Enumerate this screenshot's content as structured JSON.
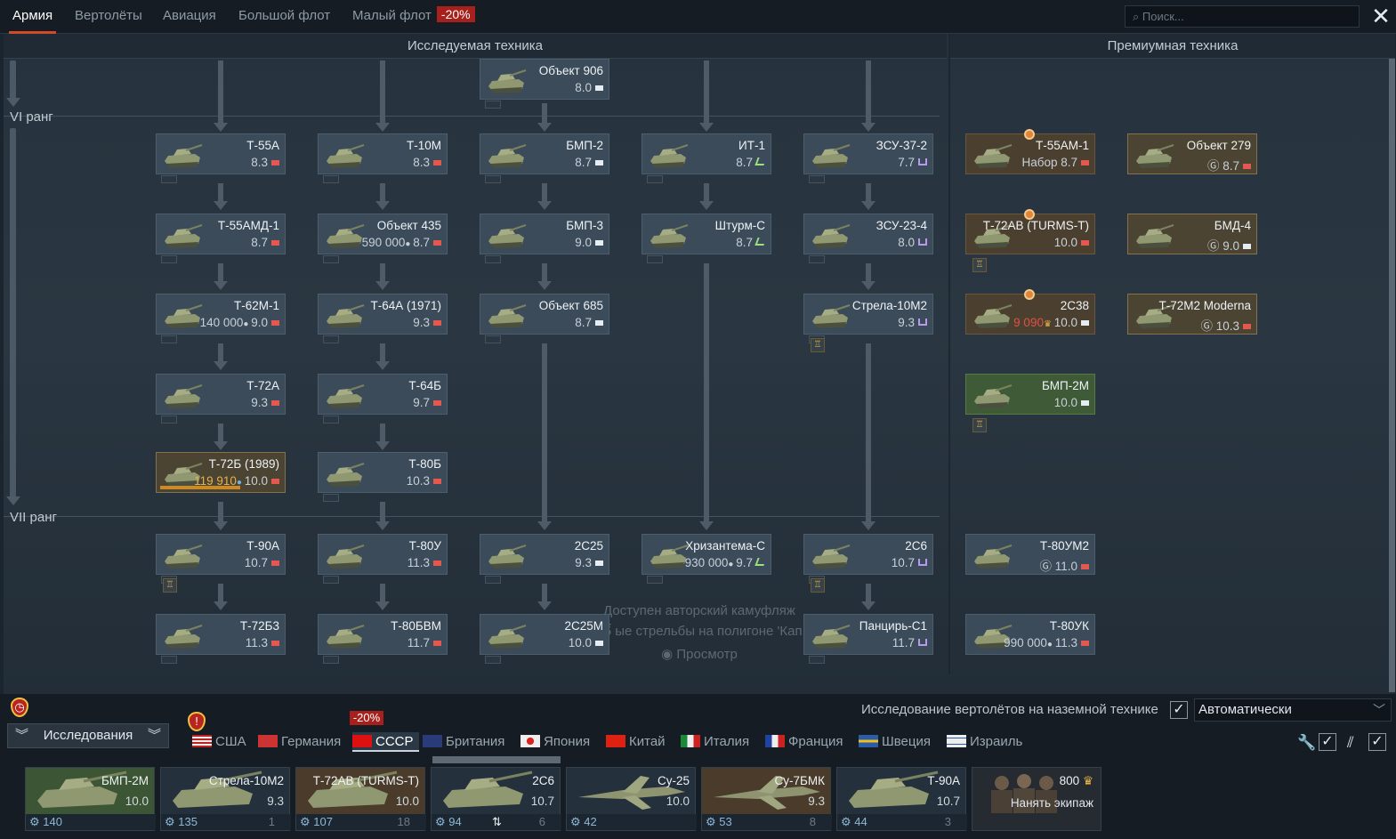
{
  "top_tabs": [
    {
      "label": "Армия",
      "active": true
    },
    {
      "label": "Вертолёты"
    },
    {
      "label": "Авиация"
    },
    {
      "label": "Большой флот"
    },
    {
      "label": "Малый флот",
      "discount": "-20%"
    }
  ],
  "search": {
    "placeholder": "Поиск..."
  },
  "sections": {
    "research": "Исследуемая техника",
    "premium": "Премиумная техника"
  },
  "ranks": {
    "vi": "VI ранг",
    "vii": "VII ранг"
  },
  "vehicles": [
    {
      "id": "obj906",
      "name": "Объект 906",
      "br": "8.0",
      "type": "light"
    },
    {
      "id": "t55a",
      "name": "Т-55А",
      "br": "8.3",
      "type": "mt"
    },
    {
      "id": "t10m",
      "name": "Т-10М",
      "br": "8.3",
      "type": "ht"
    },
    {
      "id": "bmp2",
      "name": "БМП-2",
      "br": "8.7",
      "type": "light"
    },
    {
      "id": "it1",
      "name": "ИТ-1",
      "br": "8.7",
      "type": "atgm"
    },
    {
      "id": "zsu37",
      "name": "ЗСУ-37-2",
      "br": "7.7",
      "type": "aa"
    },
    {
      "id": "t55am1",
      "name": "Т-55АМ-1",
      "prefix": "Набор",
      "br": "8.7",
      "type": "mt"
    },
    {
      "id": "obj279",
      "name": "Объект 279",
      "prefix": "Ⓖ",
      "br": "8.7",
      "type": "ht"
    },
    {
      "id": "t55amd1",
      "name": "Т-55АМД-1",
      "br": "8.7",
      "type": "mt"
    },
    {
      "id": "obj435",
      "name": "Объект 435",
      "cost": "590 000",
      "br": "8.7",
      "type": "mt"
    },
    {
      "id": "bmp3",
      "name": "БМП-3",
      "br": "9.0",
      "type": "light"
    },
    {
      "id": "shturm",
      "name": "Штурм-С",
      "br": "8.7",
      "type": "atgm"
    },
    {
      "id": "zsu23",
      "name": "ЗСУ-23-4",
      "br": "8.0",
      "type": "aa"
    },
    {
      "id": "t72av",
      "name": "Т-72АВ (TURMS-T)",
      "br": "10.0",
      "type": "mt"
    },
    {
      "id": "bmd4",
      "name": "БМД-4",
      "prefix": "Ⓖ",
      "br": "9.0",
      "type": "light"
    },
    {
      "id": "t62m1",
      "name": "Т-62М-1",
      "cost": "140 000",
      "br": "9.0",
      "type": "mt"
    },
    {
      "id": "t64a",
      "name": "Т-64А (1971)",
      "br": "9.3",
      "type": "mt"
    },
    {
      "id": "obj685",
      "name": "Объект 685",
      "br": "8.7",
      "type": "light"
    },
    {
      "id": "strela",
      "name": "Стрела-10М2",
      "br": "9.3",
      "type": "aa"
    },
    {
      "id": "2s38",
      "name": "2С38",
      "cost": "9 090",
      "br": "10.0",
      "type": "light"
    },
    {
      "id": "t72m2",
      "name": "Т-72М2 Moderna",
      "prefix": "Ⓖ",
      "br": "10.3",
      "type": "mt"
    },
    {
      "id": "t72a",
      "name": "Т-72А",
      "br": "9.3",
      "type": "mt"
    },
    {
      "id": "t64b",
      "name": "Т-64Б",
      "br": "9.7",
      "type": "mt"
    },
    {
      "id": "bmp2m",
      "name": "БМП-2М",
      "br": "10.0",
      "type": "light"
    },
    {
      "id": "t72b",
      "name": "Т-72Б (1989)",
      "cost": "119 910",
      "br": "10.0",
      "type": "mt"
    },
    {
      "id": "t80b",
      "name": "Т-80Б",
      "br": "10.3",
      "type": "mt"
    },
    {
      "id": "t90a",
      "name": "Т-90А",
      "br": "10.7",
      "type": "mt"
    },
    {
      "id": "t80u",
      "name": "Т-80У",
      "br": "11.3",
      "type": "mt"
    },
    {
      "id": "2s25",
      "name": "2С25",
      "br": "9.3",
      "type": "light"
    },
    {
      "id": "khriz",
      "name": "Хризантема-С",
      "cost": "930 000",
      "br": "9.7",
      "type": "atgm"
    },
    {
      "id": "2s6",
      "name": "2С6",
      "br": "10.7",
      "type": "aa"
    },
    {
      "id": "t80um2",
      "name": "Т-80УМ2",
      "prefix": "Ⓖ",
      "br": "11.0",
      "type": "mt"
    },
    {
      "id": "t72b3",
      "name": "Т-72Б3",
      "br": "11.3",
      "type": "mt"
    },
    {
      "id": "t80bvm",
      "name": "Т-80БВМ",
      "br": "11.7",
      "type": "mt"
    },
    {
      "id": "2s25m",
      "name": "2С25М",
      "br": "10.0",
      "type": "light"
    },
    {
      "id": "pantsir",
      "name": "Панцирь-С1",
      "br": "11.7",
      "type": "aa"
    },
    {
      "id": "t80uk",
      "name": "Т-80УК",
      "cost": "990 000",
      "br": "11.3",
      "type": "mt"
    }
  ],
  "ghost_text": {
    "line1": "Доступен авторский камуфляж",
    "line2": "25́ ые стрельбы на полигоне 'Кап",
    "line3": "Просмотр"
  },
  "heli_research": {
    "label": "Исследование вертолётов на наземной технике",
    "mode": "Автоматически"
  },
  "research_button": "Исследования",
  "nations": [
    {
      "label": "США"
    },
    {
      "label": "Германия"
    },
    {
      "label": "СССР",
      "active": true,
      "discount": "-20%"
    },
    {
      "label": "Британия"
    },
    {
      "label": "Япония"
    },
    {
      "label": "Китай"
    },
    {
      "label": "Италия"
    },
    {
      "label": "Франция"
    },
    {
      "label": "Швеция"
    },
    {
      "label": "Израиль"
    }
  ],
  "crew": [
    {
      "name": "БМП-2М",
      "br": "10.0",
      "count": "140",
      "right": ""
    },
    {
      "name": "Стрела-10М2",
      "br": "9.3",
      "count": "135",
      "right": "1"
    },
    {
      "name": "Т-72АВ (TURMS-T)",
      "br": "10.0",
      "count": "107",
      "right": "18"
    },
    {
      "name": "2С6",
      "br": "10.7",
      "count": "94",
      "right": "6",
      "mid": "⇅"
    },
    {
      "name": "Су-25",
      "br": "10.0",
      "count": "42",
      "right": ""
    },
    {
      "name": "Су-7БМК",
      "br": "9.3",
      "count": "53",
      "right": "8"
    },
    {
      "name": "Т-90А",
      "br": "10.7",
      "count": "44",
      "right": "3"
    }
  ],
  "hire": {
    "cost": "800",
    "label": "Нанять экипаж"
  },
  "colors": {
    "accent": "#d24a2a",
    "discount": "#a8201c",
    "research_card": "#3b4b59",
    "premium_card": "#4b3f30",
    "researched_card": "#3f5a36"
  }
}
